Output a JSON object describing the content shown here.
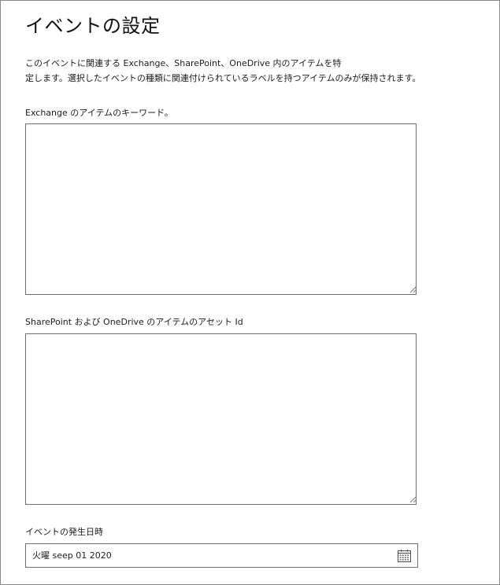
{
  "page": {
    "title": "イベントの設定",
    "description_line1": "このイベントに関連する Exchange、SharePoint、OneDrive 内のアイテムを特",
    "description_line2": "定します。選択したイベントの種類に関連付けられているラベルを持つアイテムのみが保持されます。"
  },
  "exchange_keywords": {
    "label": "Exchange のアイテムのキーワード。",
    "value": ""
  },
  "asset_id": {
    "label": "SharePoint および OneDrive のアイテムのアセット Id",
    "value": ""
  },
  "event_date": {
    "label": "イベントの発生日時",
    "value": "火曜 seep 01 2020",
    "icon": "calendar-icon"
  },
  "colors": {
    "border": "#6e6e6e",
    "text": "#1b1b1b",
    "frame_border": "#8a8a8a"
  }
}
